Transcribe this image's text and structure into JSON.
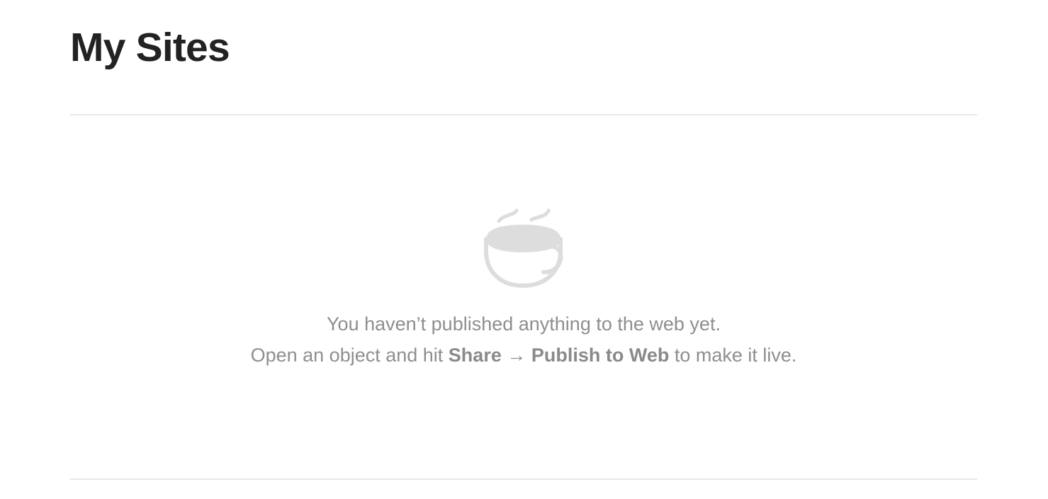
{
  "page": {
    "title": "My Sites"
  },
  "empty_state": {
    "icon": "coffee-cup-icon",
    "line1": "You haven’t published anything to the web yet.",
    "line2_prefix": "Open an object and hit ",
    "line2_action": "Share → Publish to Web",
    "line2_suffix": " to make it live."
  },
  "colors": {
    "title": "#222222",
    "message_text": "#8e8e8e",
    "icon": "#dddddd",
    "divider": "#e8e8e8"
  }
}
